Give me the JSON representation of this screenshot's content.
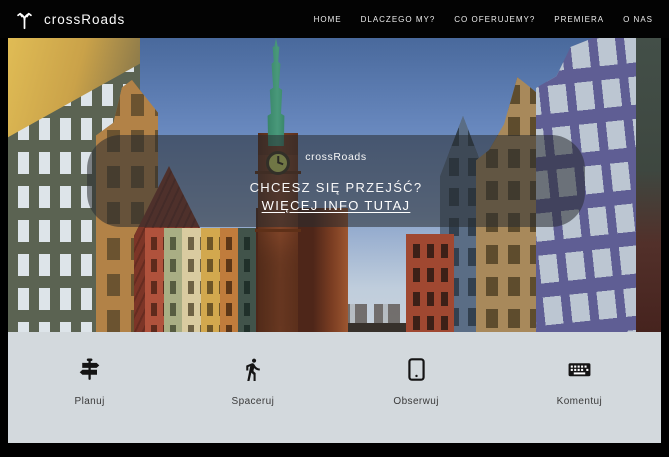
{
  "brand": {
    "name": "crossRoads",
    "logo_icon": "fork-road-icon"
  },
  "nav": {
    "items": [
      {
        "label": "HOME"
      },
      {
        "label": "DLACZEGO MY?"
      },
      {
        "label": "CO OFERUJEMY?"
      },
      {
        "label": "PREMIERA"
      },
      {
        "label": "O NAS"
      }
    ]
  },
  "hero": {
    "title": "crossRoads",
    "tagline": "CHCESZ SIĘ PRZEJŚĆ?",
    "cta_label": "WIĘCEJ INFO TUTAJ",
    "image_description": "Street of old town Gdańsk with brick clock tower and colorful townhouses"
  },
  "features": {
    "items": [
      {
        "icon": "signpost-icon",
        "label": "Planuj"
      },
      {
        "icon": "walking-person-icon",
        "label": "Spaceruj"
      },
      {
        "icon": "tablet-icon",
        "label": "Obserwuj"
      },
      {
        "icon": "keyboard-icon",
        "label": "Komentuj"
      }
    ]
  },
  "colors": {
    "nav_bg": "#030303",
    "overlay_bg": "rgba(40,44,48,0.55)",
    "section_bg": "#d3d9dd",
    "text_light": "#ffffff",
    "text_dark": "#3a3a3a"
  }
}
